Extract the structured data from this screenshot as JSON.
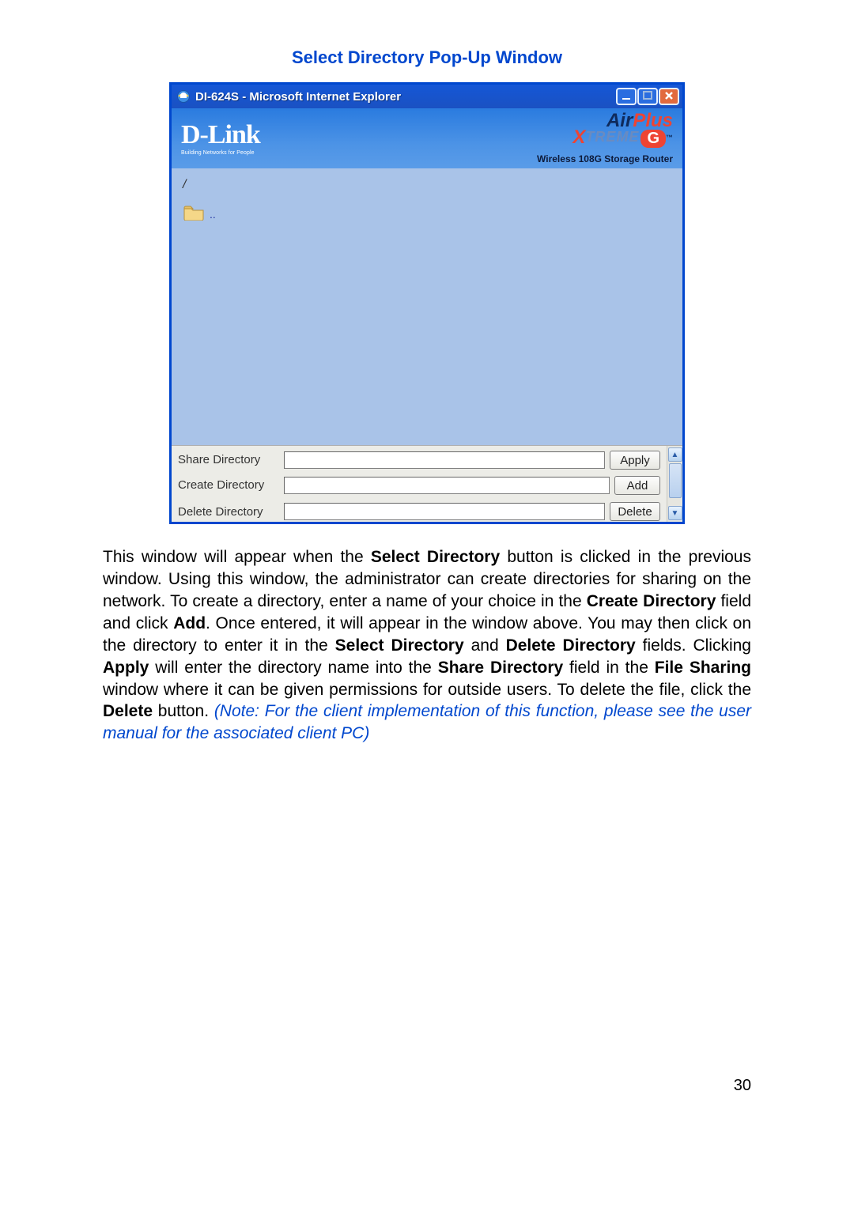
{
  "heading": "Select Directory Pop-Up Window",
  "window": {
    "title": "DI-624S - Microsoft Internet Explorer",
    "icon_name": "ie-icon"
  },
  "banner": {
    "brand_main": "D-Link",
    "brand_tag": "Building Networks for People",
    "model_line1_a": "Air",
    "model_line1_b": "Plus",
    "model_line2_x": "X",
    "model_line2_treme": "TREME",
    "model_line2_g": "G",
    "tm": "™",
    "subtitle": "Wireless 108G Storage Router"
  },
  "browser": {
    "path": "/",
    "parent_link": ".."
  },
  "form": {
    "share": {
      "label": "Share Directory",
      "button": "Apply"
    },
    "create": {
      "label": "Create Directory",
      "button": "Add"
    },
    "delete": {
      "label": "Delete Directory",
      "button": "Delete"
    }
  },
  "body": {
    "p": "This window will appear when the {b}Select Directory{/b} button is clicked in the previous window. Using this window, the administrator can create directories for sharing on the network. To create a directory, enter a name of your choice in the {b}Create Directory{/b} field and click {b}Add{/b}. Once entered, it will appear in the window above. You may then click on the directory to enter it in the {b}Select Directory{/b} and {b}Delete Directory{/b} fields. Clicking {b}Apply{/b} will enter the directory name into the {b}Share Directory{/b} field in the {b}File Sharing{/b} window where it can be given permissions for outside users. To delete the file, click the {b}Delete{/b} button. ",
    "note": "(Note: For the client implementation of this function, please see the user manual for the associated client PC)"
  },
  "page_number": "30"
}
